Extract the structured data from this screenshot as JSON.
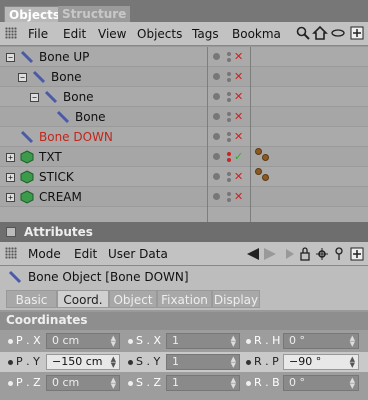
{
  "tabs": [
    {
      "label": "Objects"
    },
    {
      "label": "Structure"
    }
  ],
  "menu": {
    "items": [
      "File",
      "Edit",
      "View",
      "Objects",
      "Tags",
      "Bookma"
    ]
  },
  "tree": {
    "rows": [
      {
        "name": "Bone UP",
        "color": "#101010"
      },
      {
        "name": "Bone",
        "color": "#101010"
      },
      {
        "name": "Bone",
        "color": "#101010"
      },
      {
        "name": "Bone",
        "color": "#101010"
      },
      {
        "name": "Bone DOWN",
        "color": "#c0261c"
      },
      {
        "name": "TXT",
        "color": "#101010"
      },
      {
        "name": "STICK",
        "color": "#101010"
      },
      {
        "name": "CREAM",
        "color": "#101010"
      }
    ]
  },
  "attributes": {
    "title": "Attributes",
    "menu": [
      "Mode",
      "Edit",
      "User Data"
    ],
    "object_label": "Bone Object [Bone DOWN]",
    "subtabs": [
      "Basic",
      "Coord.",
      "Object",
      "Fixation",
      "Display"
    ],
    "section": "Coordinates",
    "coords": [
      [
        {
          "label": "P . X",
          "value": "0 cm"
        },
        {
          "label": "S . X",
          "value": "1"
        },
        {
          "label": "R . H",
          "value": "0 °"
        }
      ],
      [
        {
          "label": "P . Y",
          "value": "−150 cm"
        },
        {
          "label": "S . Y",
          "value": "1"
        },
        {
          "label": "R . P",
          "value": "−90 °"
        }
      ],
      [
        {
          "label": "P . Z",
          "value": "0 cm"
        },
        {
          "label": "S . Z",
          "value": "1"
        },
        {
          "label": "R . B",
          "value": "0 °"
        }
      ]
    ]
  },
  "colors": {
    "accent_red": "#c0261c",
    "tag_brown": "#8a5a22"
  }
}
